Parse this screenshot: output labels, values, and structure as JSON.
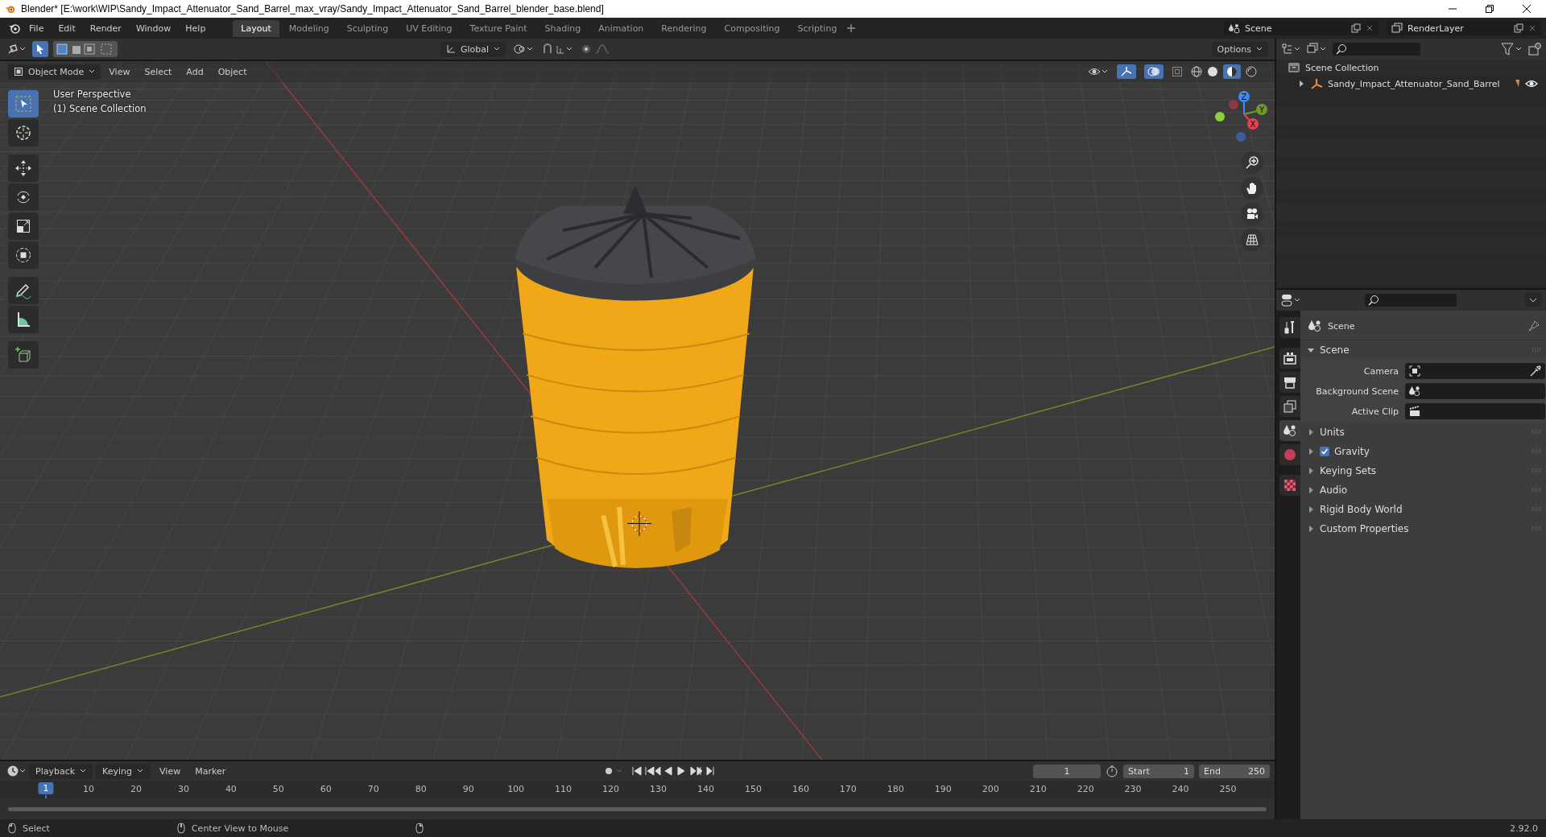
{
  "title_bar": {
    "title": "Blender* [E:\\work\\WIP\\Sandy_Impact_Attenuator_Sand_Barrel_max_vray/Sandy_Impact_Attenuator_Sand_Barrel_blender_base.blend]"
  },
  "menu": [
    "File",
    "Edit",
    "Render",
    "Window",
    "Help"
  ],
  "workspaces": [
    {
      "label": "Layout",
      "selected": true
    },
    {
      "label": "Modeling",
      "selected": false
    },
    {
      "label": "Sculpting",
      "selected": false
    },
    {
      "label": "UV Editing",
      "selected": false
    },
    {
      "label": "Texture Paint",
      "selected": false
    },
    {
      "label": "Shading",
      "selected": false
    },
    {
      "label": "Animation",
      "selected": false
    },
    {
      "label": "Rendering",
      "selected": false
    },
    {
      "label": "Compositing",
      "selected": false
    },
    {
      "label": "Scripting",
      "selected": false
    }
  ],
  "scene_field": "Scene",
  "view_layer_field": "RenderLayer",
  "tool_header": {
    "orientation": "Global",
    "options": "Options"
  },
  "viewport_header": {
    "mode": "Object Mode",
    "menus": [
      "View",
      "Select",
      "Add",
      "Object"
    ]
  },
  "viewport": {
    "perspective": "User Perspective",
    "collection": "(1) Scene Collection"
  },
  "gizmo": {
    "z": "Z",
    "y": "Y",
    "x": "X"
  },
  "tools": [
    {
      "kind": "select-box",
      "selected": true
    },
    {
      "kind": "cursor",
      "selected": false
    },
    {
      "kind": "move",
      "selected": false
    },
    {
      "kind": "rotate",
      "selected": false
    },
    {
      "kind": "scale",
      "selected": false
    },
    {
      "kind": "transform",
      "selected": false
    },
    {
      "kind": "annotate",
      "selected": false
    },
    {
      "kind": "measure",
      "selected": false
    },
    {
      "kind": "add-cube",
      "selected": false
    }
  ],
  "outliner": {
    "root": "Scene Collection",
    "items": [
      {
        "label": "Sandy_Impact_Attenuator_Sand_Barrel",
        "expanded": false
      }
    ]
  },
  "properties": {
    "tabs": [
      {
        "kind": "tool",
        "selected": false
      },
      {
        "kind": "render",
        "selected": false
      },
      {
        "kind": "output",
        "selected": false
      },
      {
        "kind": "view-layer",
        "selected": false
      },
      {
        "kind": "scene",
        "selected": true
      },
      {
        "kind": "world",
        "selected": false
      },
      {
        "kind": "texture",
        "selected": false
      }
    ],
    "context": "Scene",
    "panel": {
      "title": "Scene",
      "expanded": true,
      "fields": [
        {
          "label": "Camera",
          "kind": "camera"
        },
        {
          "label": "Background Scene",
          "kind": "scene"
        },
        {
          "label": "Active Clip",
          "kind": "clip"
        }
      ]
    },
    "subpanels": [
      {
        "label": "Units",
        "kind": "plain"
      },
      {
        "label": "Gravity",
        "kind": "checkbox",
        "checked": true
      },
      {
        "label": "Keying Sets",
        "kind": "plain"
      },
      {
        "label": "Audio",
        "kind": "plain"
      },
      {
        "label": "Rigid Body World",
        "kind": "plain"
      },
      {
        "label": "Custom Properties",
        "kind": "plain"
      }
    ]
  },
  "timeline": {
    "menus": [
      "Playback",
      "Keying",
      "View",
      "Marker"
    ],
    "current_frame": "1",
    "start_label": "Start",
    "start": "1",
    "end_label": "End",
    "end": "250",
    "ruler": [
      {
        "label": "1",
        "selected": true
      },
      {
        "label": "10",
        "selected": false
      },
      {
        "label": "20",
        "selected": false
      },
      {
        "label": "30",
        "selected": false
      },
      {
        "label": "40",
        "selected": false
      },
      {
        "label": "50",
        "selected": false
      },
      {
        "label": "60",
        "selected": false
      },
      {
        "label": "70",
        "selected": false
      },
      {
        "label": "80",
        "selected": false
      },
      {
        "label": "90",
        "selected": false
      },
      {
        "label": "100",
        "selected": false
      },
      {
        "label": "110",
        "selected": false
      },
      {
        "label": "120",
        "selected": false
      },
      {
        "label": "130",
        "selected": false
      },
      {
        "label": "140",
        "selected": false
      },
      {
        "label": "150",
        "selected": false
      },
      {
        "label": "160",
        "selected": false
      },
      {
        "label": "170",
        "selected": false
      },
      {
        "label": "180",
        "selected": false
      },
      {
        "label": "190",
        "selected": false
      },
      {
        "label": "200",
        "selected": false
      },
      {
        "label": "210",
        "selected": false
      },
      {
        "label": "220",
        "selected": false
      },
      {
        "label": "230",
        "selected": false
      },
      {
        "label": "240",
        "selected": false
      },
      {
        "label": "250",
        "selected": false
      }
    ]
  },
  "status_bar": {
    "items": [
      "Select",
      "Center View to Mouse"
    ],
    "version": "2.92.0"
  }
}
